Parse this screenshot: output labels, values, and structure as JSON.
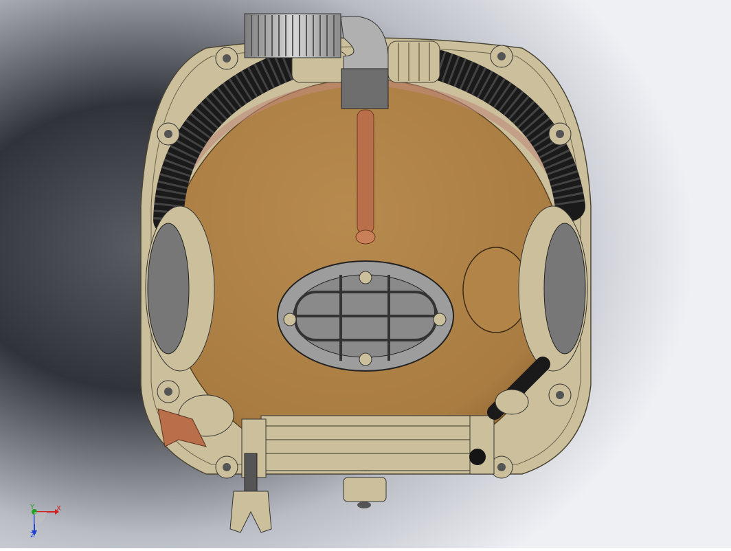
{
  "viewport": {
    "background_top": "#c9ccd3",
    "background_mid": "#3a3d43",
    "background_bottom": "#ffffff"
  },
  "model": {
    "bronze": "#b38448",
    "brass": "#cbbf9c",
    "brass_dark": "#9c916f",
    "hose": "#1a1a1a",
    "copper_pipe": "#b96f4a",
    "glass": "#8a8a8a"
  },
  "triad": {
    "x_label": "X",
    "y_label": "Y",
    "z_label": "Z",
    "x_color": "#d02020",
    "y_color": "#20a020",
    "z_color": "#2040d0"
  }
}
